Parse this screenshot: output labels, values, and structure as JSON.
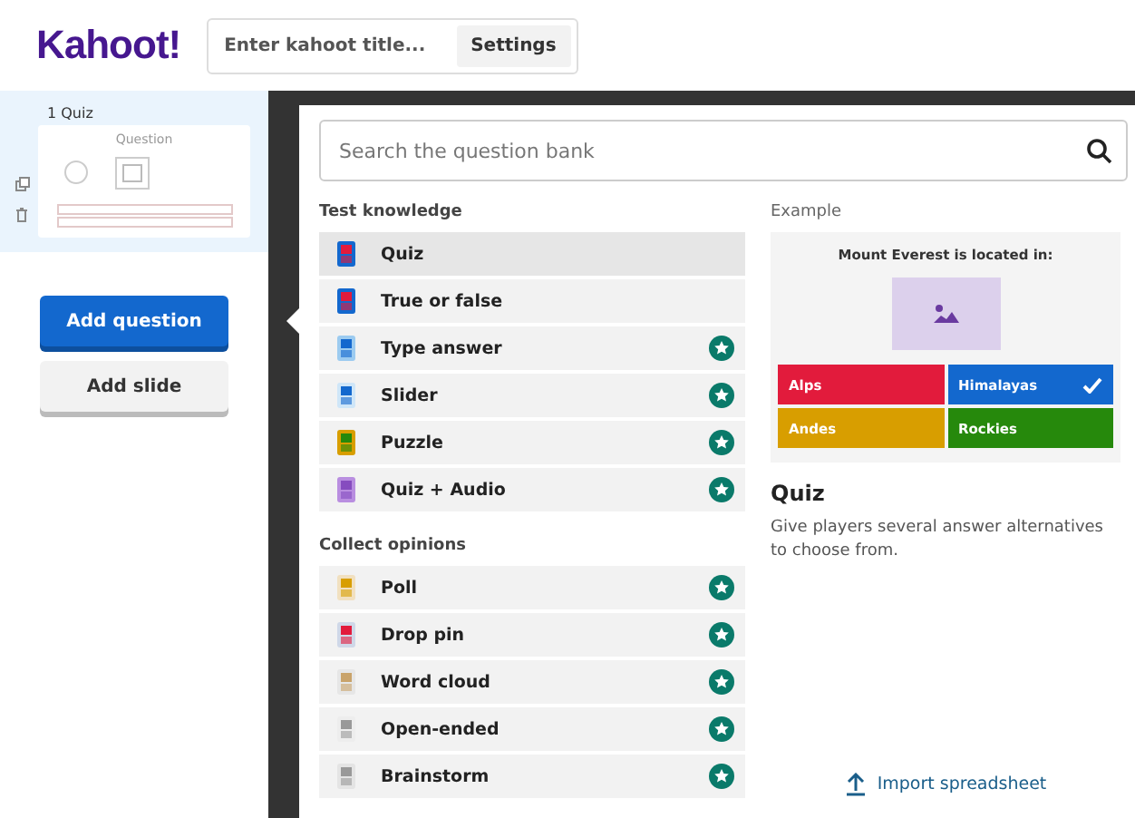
{
  "header": {
    "logo": "Kahoot!",
    "title_placeholder": "Enter kahoot title...",
    "settings_button": "Settings"
  },
  "sidebar": {
    "slides": [
      {
        "label": "1 Quiz",
        "type": "Question",
        "selected": true
      }
    ],
    "add_question": "Add question",
    "add_slide": "Add slide"
  },
  "search": {
    "placeholder": "Search the question bank"
  },
  "sections": [
    {
      "title": "Test knowledge",
      "items": [
        {
          "label": "Quiz",
          "premium": false,
          "selected": true
        },
        {
          "label": "True or false",
          "premium": false,
          "selected": false
        },
        {
          "label": "Type answer",
          "premium": true,
          "selected": false
        },
        {
          "label": "Slider",
          "premium": true,
          "selected": false
        },
        {
          "label": "Puzzle",
          "premium": true,
          "selected": false
        },
        {
          "label": "Quiz + Audio",
          "premium": true,
          "selected": false
        }
      ]
    },
    {
      "title": "Collect opinions",
      "items": [
        {
          "label": "Poll",
          "premium": true,
          "selected": false
        },
        {
          "label": "Drop pin",
          "premium": true,
          "selected": false
        },
        {
          "label": "Word cloud",
          "premium": true,
          "selected": false
        },
        {
          "label": "Open-ended",
          "premium": true,
          "selected": false
        },
        {
          "label": "Brainstorm",
          "premium": true,
          "selected": false
        }
      ]
    }
  ],
  "example": {
    "heading": "Example",
    "question": "Mount Everest is located in:",
    "answers": [
      {
        "text": "Alps",
        "color": "#e21b3c",
        "correct": false
      },
      {
        "text": "Himalayas",
        "color": "#1368ce",
        "correct": true
      },
      {
        "text": "Andes",
        "color": "#d89e00",
        "correct": false
      },
      {
        "text": "Rockies",
        "color": "#26890c",
        "correct": false
      }
    ],
    "title": "Quiz",
    "description": "Give players several answer alternatives to choose from."
  },
  "import_link": "Import spreadsheet"
}
